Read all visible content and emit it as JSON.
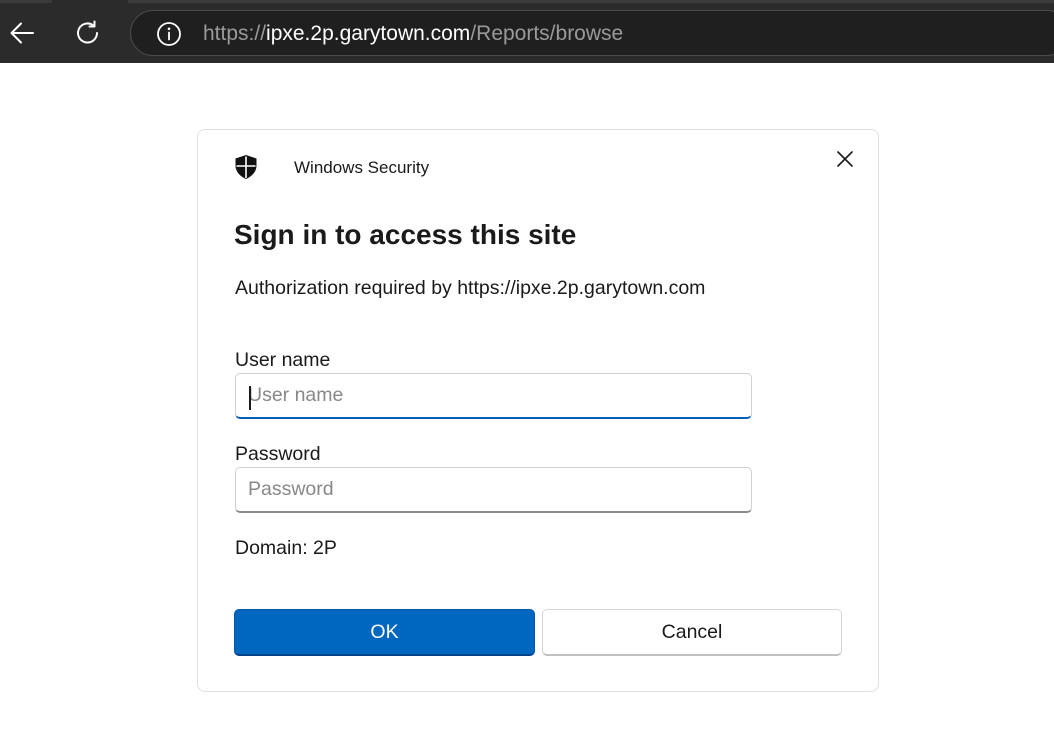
{
  "browser": {
    "url_scheme": "https://",
    "url_host": "ipxe.2p.garytown.com",
    "url_path": "/Reports/browse",
    "icons": {
      "back": "back-arrow-icon",
      "refresh": "refresh-icon",
      "info": "info-icon"
    },
    "colors": {
      "toolbar": "#2b2b2b",
      "address_bar": "#1f1f1f"
    }
  },
  "dialog": {
    "app_name": "Windows Security",
    "title": "Sign in to access this site",
    "subtitle": "Authorization required by https://ipxe.2p.garytown.com",
    "username": {
      "label": "User name",
      "placeholder": "User name",
      "value": ""
    },
    "password": {
      "label": "Password",
      "placeholder": "Password",
      "value": ""
    },
    "domain_text": "Domain: 2P",
    "ok_label": "OK",
    "cancel_label": "Cancel",
    "icons": {
      "app": "shield-icon",
      "close": "close-icon"
    },
    "colors": {
      "accent": "#0067c0",
      "focus_underline": "#005fb8"
    }
  }
}
